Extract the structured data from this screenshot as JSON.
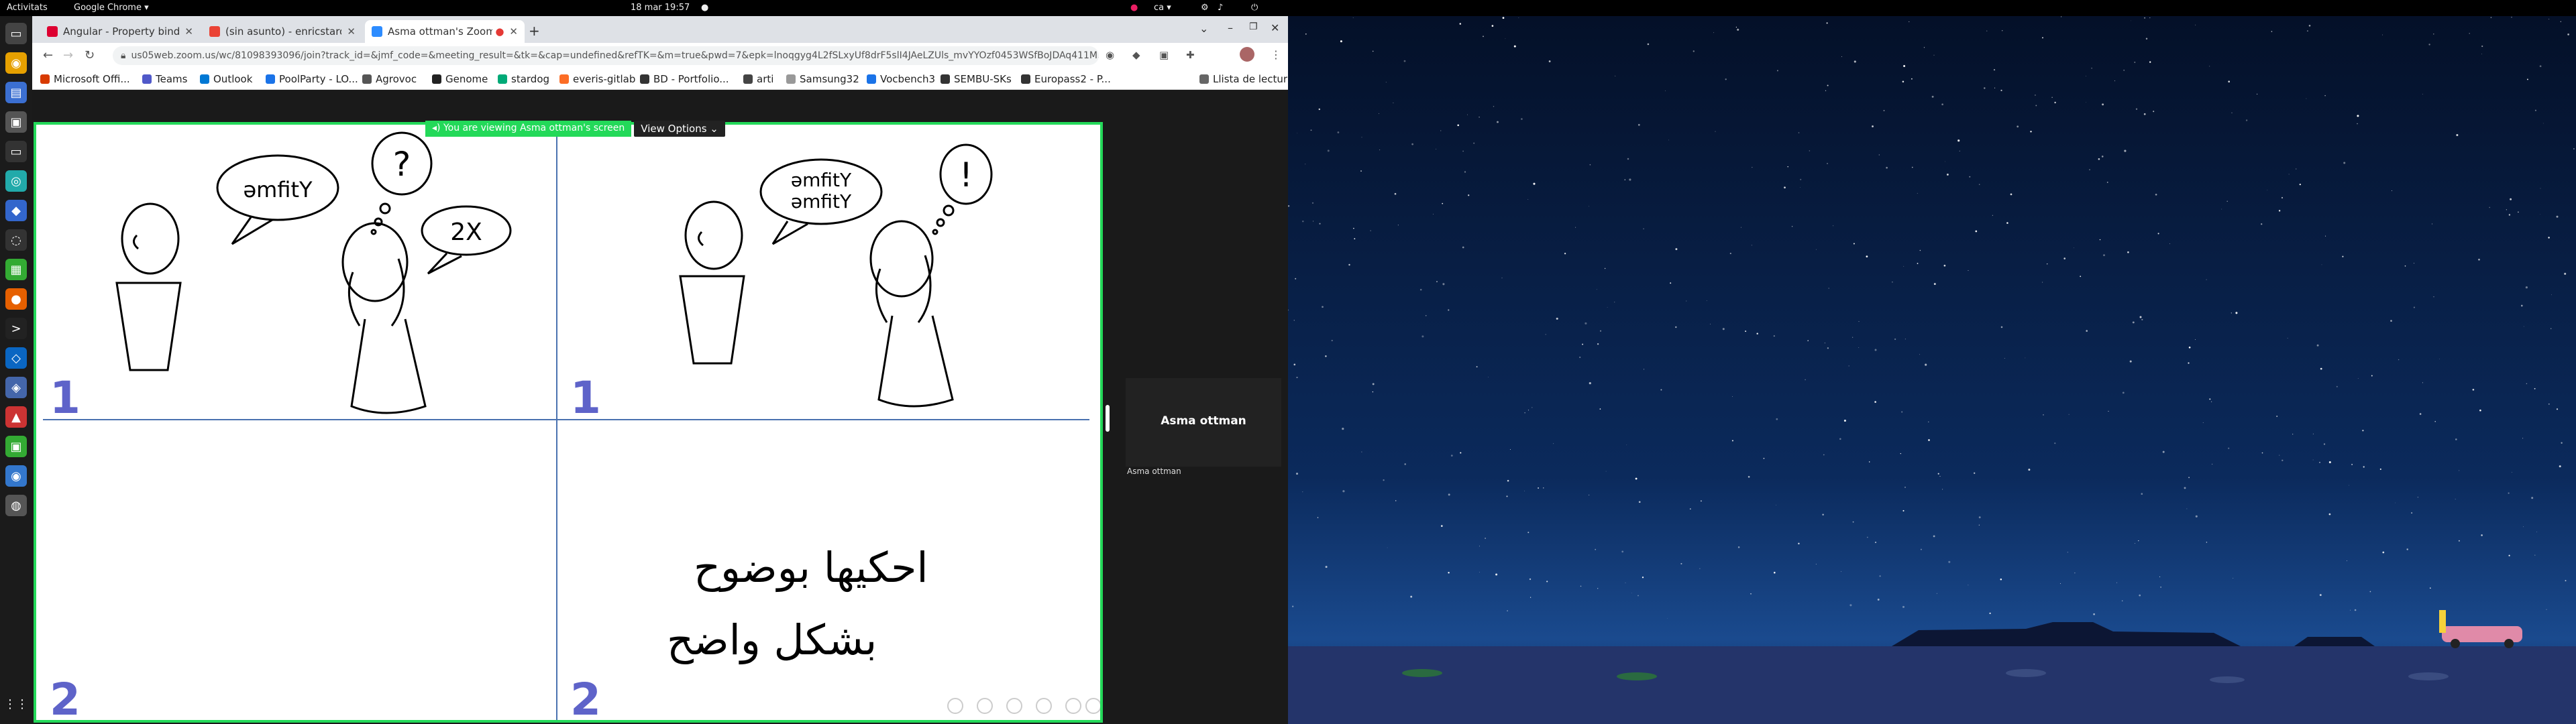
{
  "topbar": {
    "activities": "Activitats",
    "app_menu": "Google Chrome ▾",
    "datetime": "18 mar  19:57",
    "lang": "ca ▾"
  },
  "tabs": [
    {
      "label": "Angular - Property bindin",
      "fav_color": "#dd0031",
      "active": false
    },
    {
      "label": "(sin asunto) - enricstaron",
      "fav_color": "#ea4335",
      "active": false
    },
    {
      "label": "Asma ottman's Zoom",
      "fav_color": "#2d8cff",
      "active": true
    }
  ],
  "address": {
    "url": "us05web.zoom.us/wc/81098393096/join?track_id=&jmf_code=&meeting_result=&tk=&cap=undefined&refTK=&m=true&pwd=7&epk=lnoqgyg4L2fSLxyUf8drF5slI4JAeLZUls_mvYYOzf0453WSfBoJDAq411M..."
  },
  "bookmarks": [
    {
      "label": "Microsoft Offi...",
      "color": "#d83b01"
    },
    {
      "label": "Teams",
      "color": "#5059c9"
    },
    {
      "label": "Outlook",
      "color": "#0078d4"
    },
    {
      "label": "PoolParty - LO...",
      "color": "#1a73e8"
    },
    {
      "label": "Agrovoc",
      "color": "#555"
    },
    {
      "label": "Genome",
      "color": "#222"
    },
    {
      "label": "stardog",
      "color": "#0a7"
    },
    {
      "label": "everis-gitlab",
      "color": "#fc6d26"
    },
    {
      "label": "BD - Portfolio...",
      "color": "#333"
    },
    {
      "label": "arti",
      "color": "#444"
    },
    {
      "label": "Samsung32",
      "color": "#999"
    },
    {
      "label": "Vocbench3",
      "color": "#1a73e8"
    },
    {
      "label": "SEMBU-SKs",
      "color": "#333"
    },
    {
      "label": "Europass2 - P...",
      "color": "#333"
    },
    {
      "label": "Llista de lectura",
      "color": "#666"
    }
  ],
  "zoom": {
    "viewing_text": "You are viewing Asma ottman's screen",
    "view_options": "View Options ⌄",
    "participant_name": "Asma ottman",
    "participant_label": "Asma ottman"
  },
  "slide": {
    "bubble_left": "əmfitY",
    "bubble_2x": "2X",
    "bubble_right_line1": "əmfitY",
    "bubble_right_line2": "əmfitY",
    "question_mark": "?",
    "exclamation": "!",
    "num_tl": "1",
    "num_tr": "1",
    "num_bl": "2",
    "num_br": "2",
    "arabic_line1": "احكيها بوضوح",
    "arabic_line2": "بشكل واضح"
  }
}
